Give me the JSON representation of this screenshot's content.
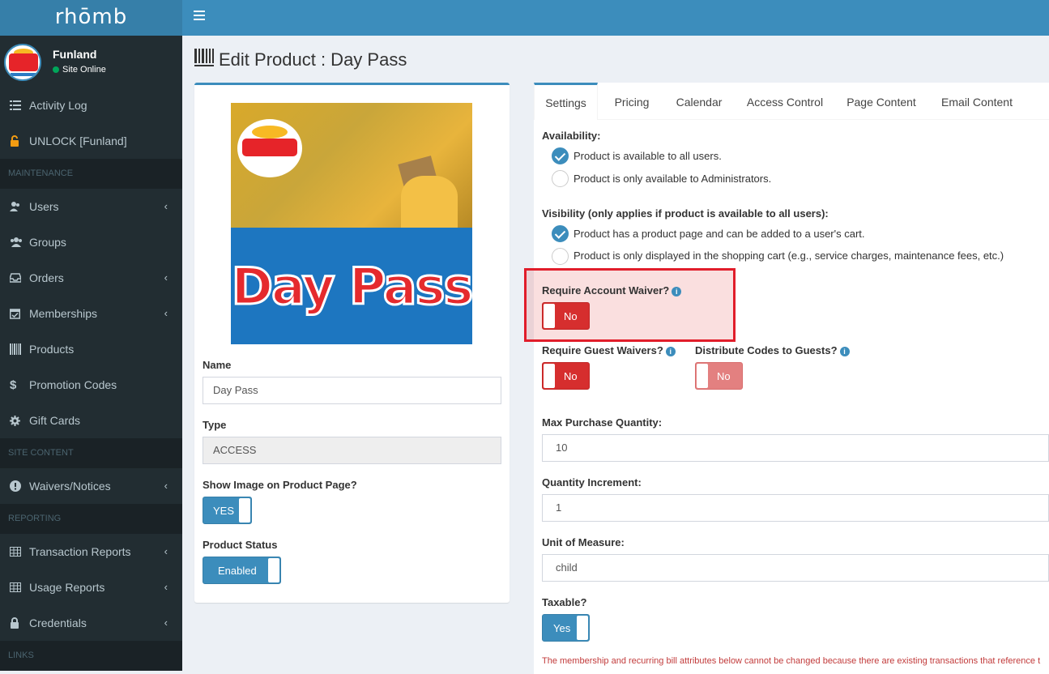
{
  "app": {
    "logo": "rhōmb"
  },
  "user": {
    "name": "Funland",
    "status": "Site Online"
  },
  "sidebar": {
    "items_top": [
      {
        "label": "Activity Log",
        "icon": "list-icon"
      },
      {
        "label": "UNLOCK [Funland]",
        "icon": "unlock-icon"
      }
    ],
    "headers": {
      "maintenance": "MAINTENANCE",
      "site_content": "SITE CONTENT",
      "reporting": "REPORTING",
      "links": "LINKS"
    },
    "maintenance": [
      {
        "label": "Users",
        "icon": "users-icon",
        "chevron": "‹"
      },
      {
        "label": "Groups",
        "icon": "groups-icon"
      },
      {
        "label": "Orders",
        "icon": "inbox-icon",
        "chevron": "‹"
      },
      {
        "label": "Memberships",
        "icon": "calendar-check-icon",
        "chevron": "‹"
      },
      {
        "label": "Products",
        "icon": "barcode-icon"
      },
      {
        "label": "Promotion Codes",
        "icon": "dollar-icon"
      },
      {
        "label": "Gift Cards",
        "icon": "gear-icon"
      }
    ],
    "site_content": [
      {
        "label": "Waivers/Notices",
        "icon": "exclamation-icon",
        "chevron": "‹"
      }
    ],
    "reporting": [
      {
        "label": "Transaction Reports",
        "icon": "table-icon",
        "chevron": "‹"
      },
      {
        "label": "Usage Reports",
        "icon": "table-icon",
        "chevron": "‹"
      },
      {
        "label": "Credentials",
        "icon": "lock-icon",
        "chevron": "‹"
      }
    ]
  },
  "page": {
    "title": "Edit Product : Day Pass"
  },
  "left_panel": {
    "image_text": "Day Pass",
    "name_label": "Name",
    "name_value": "Day Pass",
    "type_label": "Type",
    "type_value": "ACCESS",
    "show_image_label": "Show Image on Product Page?",
    "show_image_value": "YES",
    "status_label": "Product Status",
    "status_value": "Enabled"
  },
  "tabs": [
    "Settings",
    "Pricing",
    "Calendar",
    "Access Control",
    "Page Content",
    "Email Content"
  ],
  "settings": {
    "availability_label": "Availability:",
    "availability_options": [
      {
        "text": "Product is available to all users.",
        "checked": true
      },
      {
        "text": "Product is only available to Administrators.",
        "checked": false
      }
    ],
    "visibility_label": "Visibility (only applies if product is available to all users):",
    "visibility_options": [
      {
        "text": "Product has a product page and can be added to a user's cart.",
        "checked": true
      },
      {
        "text": "Product is only displayed in the shopping cart (e.g., service charges, maintenance fees, etc.)",
        "checked": false
      }
    ],
    "account_waiver_label": "Require Account Waiver?",
    "account_waiver_value": "No",
    "guest_waivers_label": "Require Guest Waivers?",
    "guest_waivers_value": "No",
    "distribute_codes_label": "Distribute Codes to Guests?",
    "distribute_codes_value": "No",
    "max_qty_label": "Max Purchase Quantity:",
    "max_qty_value": "10",
    "qty_increment_label": "Quantity Increment:",
    "qty_increment_value": "1",
    "uom_label": "Unit of Measure:",
    "uom_value": "child",
    "taxable_label": "Taxable?",
    "taxable_value": "Yes",
    "warning": "The membership and recurring bill attributes below cannot be changed because there are existing transactions that reference t"
  },
  "colors": {
    "primary": "#3c8dbc",
    "sidebar": "#222d32",
    "danger": "#d62e2e",
    "highlight": "#e11d2a"
  }
}
